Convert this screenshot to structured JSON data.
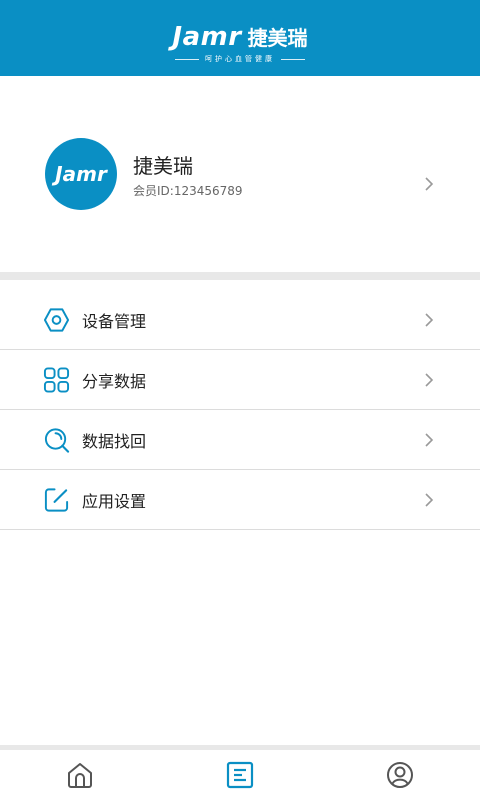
{
  "header": {
    "brand_en": "Jamr",
    "brand_cn": "捷美瑞",
    "tagline": "呵护心血管健康"
  },
  "profile": {
    "avatar_text": "Jamr",
    "name": "捷美瑞",
    "member_id": "会员ID:123456789"
  },
  "menu": [
    {
      "label": "设备管理",
      "icon": "hexagon-nut-icon"
    },
    {
      "label": "分享数据",
      "icon": "grid-icon"
    },
    {
      "label": "数据找回",
      "icon": "search-icon"
    },
    {
      "label": "应用设置",
      "icon": "edit-icon"
    }
  ],
  "tabbar": {
    "tabs": [
      {
        "icon": "home-icon",
        "active": false
      },
      {
        "icon": "list-icon",
        "active": true
      },
      {
        "icon": "user-icon",
        "active": false
      }
    ]
  },
  "colors": {
    "brand": "#0a8fc4",
    "icon_gray": "#555555",
    "chevron": "#9a9a9a"
  }
}
